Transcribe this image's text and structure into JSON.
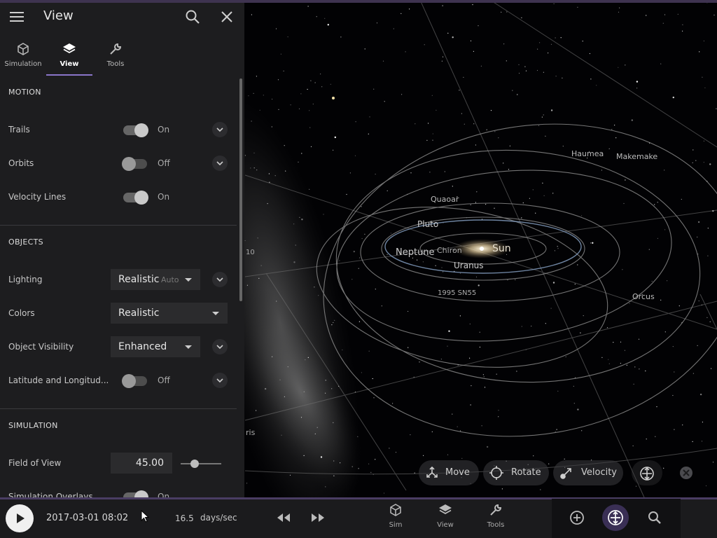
{
  "panel": {
    "title": "View",
    "tabs": [
      {
        "label": "Simulation",
        "icon": "cube-icon"
      },
      {
        "label": "View",
        "icon": "layers-icon"
      },
      {
        "label": "Tools",
        "icon": "wrench-icon"
      }
    ],
    "sections": {
      "motion": {
        "heading": "MOTION",
        "trails": {
          "label": "Trails",
          "state": "On"
        },
        "orbits": {
          "label": "Orbits",
          "state": "Off"
        },
        "velocity_lines": {
          "label": "Velocity Lines",
          "state": "On"
        }
      },
      "objects": {
        "heading": "OBJECTS",
        "lighting": {
          "label": "Lighting",
          "value": "Realistic",
          "sub": "Auto"
        },
        "colors": {
          "label": "Colors",
          "value": "Realistic"
        },
        "object_visibility": {
          "label": "Object Visibility",
          "value": "Enhanced"
        },
        "lat_long": {
          "label": "Latitude and Longitud...",
          "state": "Off"
        }
      },
      "simulation": {
        "heading": "SIMULATION",
        "field_of_view": {
          "label": "Field of View",
          "value": "45.00",
          "slider_fraction": 0.24
        },
        "overlays": {
          "label": "Simulation Overlays",
          "state": "On"
        }
      }
    }
  },
  "scene": {
    "labels": {
      "sun": "Sun",
      "neptune": "Neptune",
      "chiron": "Chiron",
      "uranus": "Uranus",
      "pluto": "Pluto",
      "quaoar": "Quaoar",
      "haumea": "Haumea",
      "makemake": "Makemake",
      "orcus": "Orcus",
      "sn55": "1995 SN55",
      "edge_10": "10",
      "edge_ris": "ris"
    }
  },
  "camera_controls": {
    "move": "Move",
    "rotate": "Rotate",
    "velocity": "Velocity"
  },
  "bottom": {
    "datetime": "2017-03-01 08:02",
    "rate_value": "16.5",
    "rate_unit": "days/sec",
    "nav": [
      {
        "label": "Sim"
      },
      {
        "label": "View"
      },
      {
        "label": "Tools"
      }
    ]
  },
  "colors": {
    "accent": "#8a75c9",
    "panel_bg": "#1d1d1f",
    "active_circle": "#3a2f55"
  }
}
